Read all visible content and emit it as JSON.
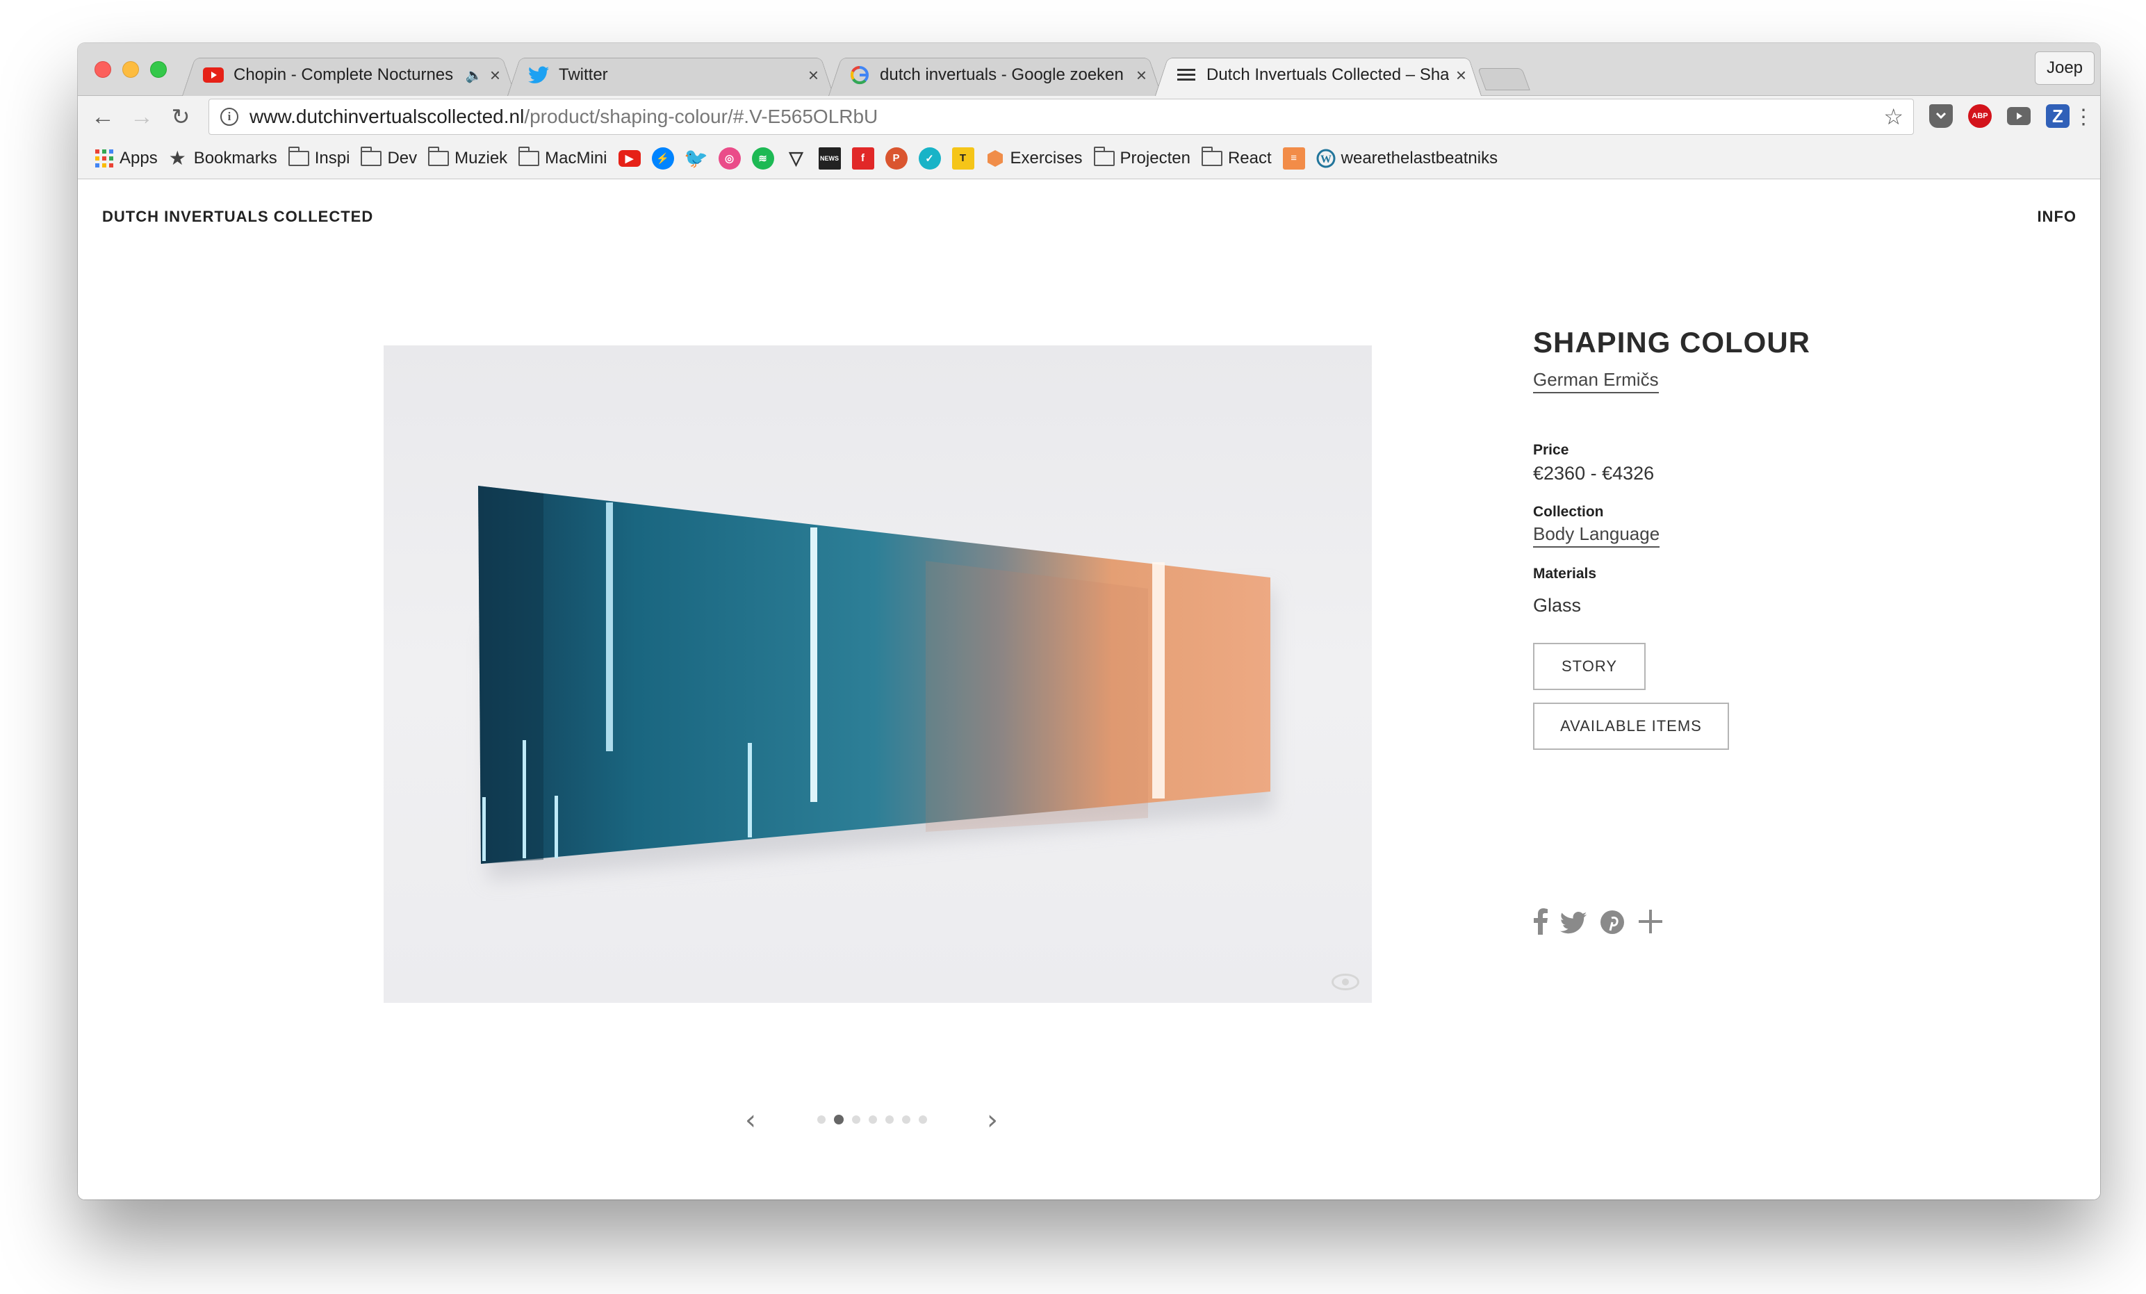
{
  "browser": {
    "tabs": [
      {
        "title": "Chopin - Complete Nocturnes",
        "favicon": "youtube-icon",
        "audible": true
      },
      {
        "title": "Twitter",
        "favicon": "twitter-icon"
      },
      {
        "title": "dutch invertuals - Google zoeken",
        "favicon": "google-icon"
      },
      {
        "title": "Dutch Invertuals Collected – Shaping Colour",
        "favicon": "menu-icon",
        "active": true
      }
    ],
    "profile": "Joep",
    "url": {
      "domain": "www.dutchinvertualscollected.nl",
      "path": "/product/shaping-colour/#.V-E565OLRbU"
    },
    "bookmarks": [
      {
        "label": "Apps",
        "icon": "apps-grid-icon"
      },
      {
        "label": "Bookmarks",
        "icon": "star-icon"
      },
      {
        "label": "Inspi",
        "icon": "folder-icon"
      },
      {
        "label": "Dev",
        "icon": "folder-icon"
      },
      {
        "label": "Muziek",
        "icon": "folder-icon"
      },
      {
        "label": "MacMini",
        "icon": "folder-icon"
      },
      {
        "label": "Exercises",
        "icon": "hexagon-icon"
      },
      {
        "label": "Projecten",
        "icon": "folder-icon"
      },
      {
        "label": "React",
        "icon": "folder-icon"
      },
      {
        "label": "wearethelastbeatniks",
        "icon": "wordpress-icon"
      }
    ],
    "extensions": [
      "pocket-icon",
      "adblock-icon",
      "youtube-ext-icon",
      "z-icon",
      "more-icon"
    ]
  },
  "site": {
    "logo": "DUTCH INVERTUALS COLLECTED",
    "nav_info": "INFO"
  },
  "product": {
    "title": "SHAPING COLOUR",
    "designer": "German Ermičs",
    "price_label": "Price",
    "price": "€2360 - €4326",
    "collection_label": "Collection",
    "collection": "Body Language",
    "materials_label": "Materials",
    "materials": "Glass",
    "story_button": "STORY",
    "available_button": "AVAILABLE ITEMS",
    "gallery_count": 7,
    "gallery_current": 2
  },
  "colors": {
    "mirror_blue": "#1c6f86",
    "mirror_orange": "#e8a079"
  }
}
